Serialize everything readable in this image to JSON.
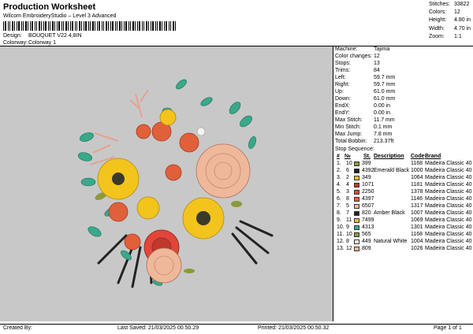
{
  "header": {
    "title": "Production Worksheet",
    "subtitle": "Wilcom EmbroideryStudio – Level 3 Advanced",
    "design_label": "Design:",
    "design_value": "BOUQUET V22 4,8IN",
    "colorway_label": "Colorway:",
    "colorway_value": "Colorway 1"
  },
  "summary": [
    {
      "k": "Stitches:",
      "v": "33822"
    },
    {
      "k": "Colors:",
      "v": "12"
    },
    {
      "k": "Height:",
      "v": "4.80 in"
    },
    {
      "k": "Width:",
      "v": "4.70 in"
    },
    {
      "k": "Zoom:",
      "v": "1:1"
    }
  ],
  "props": [
    {
      "k": "Machine:",
      "v": "Tajima"
    },
    {
      "k": "Color changes:",
      "v": "12"
    },
    {
      "k": "Stops:",
      "v": "13"
    },
    {
      "k": "Trims:",
      "v": "84"
    },
    {
      "k": "Left:",
      "v": "59.7 mm"
    },
    {
      "k": "Right:",
      "v": "59.7 mm"
    },
    {
      "k": "Up:",
      "v": "61.0 mm"
    },
    {
      "k": "Down:",
      "v": "61.0 mm"
    },
    {
      "k": "EndX:",
      "v": "0.00 in"
    },
    {
      "k": "EndY:",
      "v": "0.00 in"
    },
    {
      "k": "Max Stitch:",
      "v": "11.7 mm"
    },
    {
      "k": "Min Stitch:",
      "v": "0.1 mm"
    },
    {
      "k": "Max Jump:",
      "v": "7.8 mm"
    },
    {
      "k": "Total Bobbin:",
      "v": "213.37ft"
    }
  ],
  "sequence": {
    "title": "Stop Sequence:",
    "headers": {
      "n": "#",
      "no": "№",
      "st": "St.",
      "desc": "Description",
      "code": "Code",
      "brand": "Brand"
    },
    "rows": [
      {
        "n": "1.",
        "no": "10",
        "color": "#8a9a3c",
        "st": "399",
        "desc": "",
        "code": "1168",
        "brand": "Madeira Classic 40"
      },
      {
        "n": "2.",
        "no": "6",
        "color": "#1e1e1e",
        "st": "4392",
        "desc": "Emerald Black",
        "code": "1000",
        "brand": "Madeira Classic 40"
      },
      {
        "n": "3.",
        "no": "2",
        "color": "#f2c41c",
        "st": "349",
        "desc": "",
        "code": "1064",
        "brand": "Madeira Classic 40"
      },
      {
        "n": "4.",
        "no": "4",
        "color": "#c0392b",
        "st": "1071",
        "desc": "",
        "code": "1181",
        "brand": "Madeira Classic 40"
      },
      {
        "n": "5.",
        "no": "3",
        "color": "#e2453a",
        "st": "2250",
        "desc": "",
        "code": "1378",
        "brand": "Madeira Classic 40"
      },
      {
        "n": "6.",
        "no": "8",
        "color": "#e0603a",
        "st": "4397",
        "desc": "",
        "code": "1146",
        "brand": "Madeira Classic 40"
      },
      {
        "n": "7.",
        "no": "5",
        "color": "#e8b7a2",
        "st": "6507",
        "desc": "",
        "code": "1317",
        "brand": "Madeira Classic 40"
      },
      {
        "n": "8.",
        "no": "7",
        "color": "#222222",
        "st": "820",
        "desc": "Amber Black",
        "code": "1007",
        "brand": "Madeira Classic 40"
      },
      {
        "n": "9.",
        "no": "11",
        "color": "#f0c020",
        "st": "7499",
        "desc": "",
        "code": "1069",
        "brand": "Madeira Classic 40"
      },
      {
        "n": "10.",
        "no": "9",
        "color": "#3aa88a",
        "st": "4313",
        "desc": "",
        "code": "1301",
        "brand": "Madeira Classic 40"
      },
      {
        "n": "11.",
        "no": "10",
        "color": "#8a9a3c",
        "st": "565",
        "desc": "",
        "code": "1168",
        "brand": "Madeira Classic 40"
      },
      {
        "n": "12.",
        "no": "8",
        "color": "#f5f5f0",
        "st": "449",
        "desc": "Natural White",
        "code": "1004",
        "brand": "Madeira Classic 40"
      },
      {
        "n": "13.",
        "no": "12",
        "color": "#f0b89a",
        "st": "809",
        "desc": "",
        "code": "1026",
        "brand": "Madeira Classic 40"
      }
    ]
  },
  "footer": {
    "created": "Created By:",
    "saved": "Last Saved: 21/03/2025 00.50.29",
    "printed": "Printed: 21/03/2025 00.50.32",
    "page": "Page 1 of 1"
  },
  "colors": {
    "canvas_bg": "#c8c8c8"
  }
}
